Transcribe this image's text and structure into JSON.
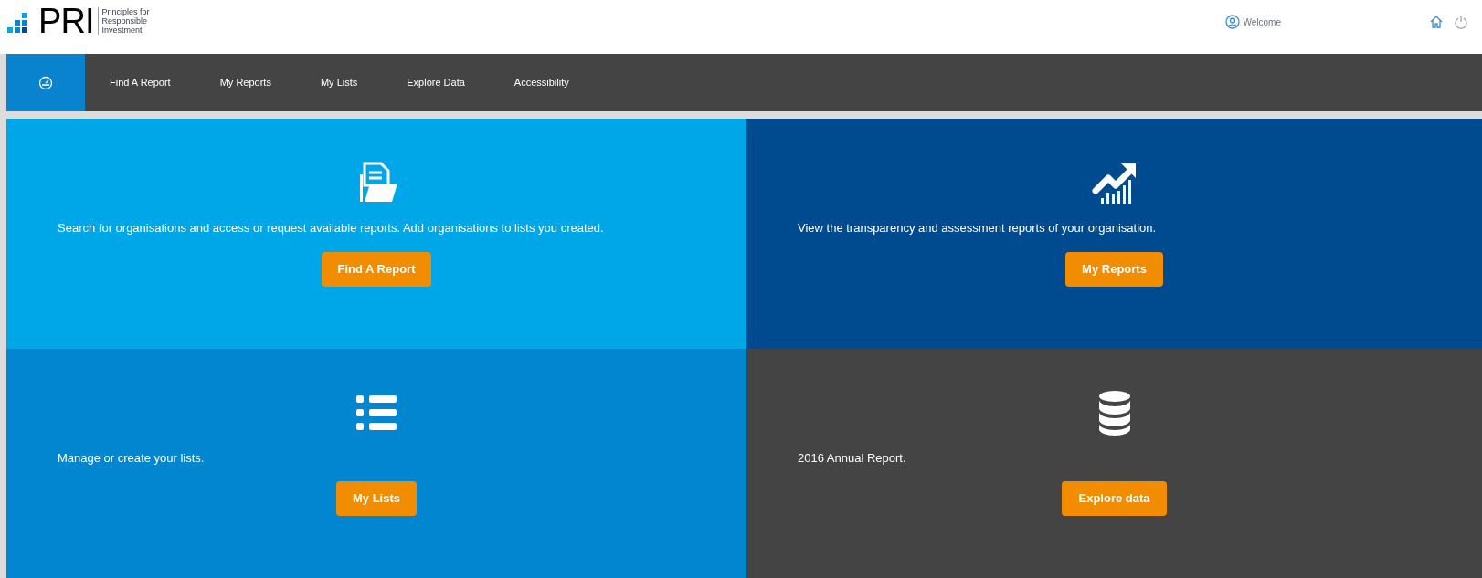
{
  "header": {
    "logo": {
      "mark": "PRI",
      "tagline": [
        "Principles for",
        "Responsible",
        "Investment"
      ]
    },
    "user": {
      "label": "Welcome"
    }
  },
  "nav": [
    {
      "kind": "icon",
      "selected": true
    },
    {
      "kind": "text",
      "label": "Find A Report",
      "selected": false
    },
    {
      "kind": "text",
      "label": "My Reports",
      "selected": false
    },
    {
      "kind": "text",
      "label": "My Lists",
      "selected": false
    },
    {
      "kind": "text",
      "label": "Explore Data",
      "selected": false
    },
    {
      "kind": "text",
      "label": "Accessibility",
      "selected": false
    }
  ],
  "tiles": [
    {
      "kind": "documents",
      "color": "#00a7e8",
      "text": "Search for organisations and access or request available reports. Add organisations to lists you created.",
      "button": "Find A Report"
    },
    {
      "kind": "growth",
      "color": "#004a8f",
      "text": "View the transparency and assessment reports of your organisation.",
      "button": "My Reports"
    },
    {
      "kind": "list",
      "color": "#0286cf",
      "text": "Manage or create your lists.",
      "button": "My Lists"
    },
    {
      "kind": "database",
      "color": "#444444",
      "text": "2016 Annual Report.",
      "button": "Explore data"
    }
  ]
}
